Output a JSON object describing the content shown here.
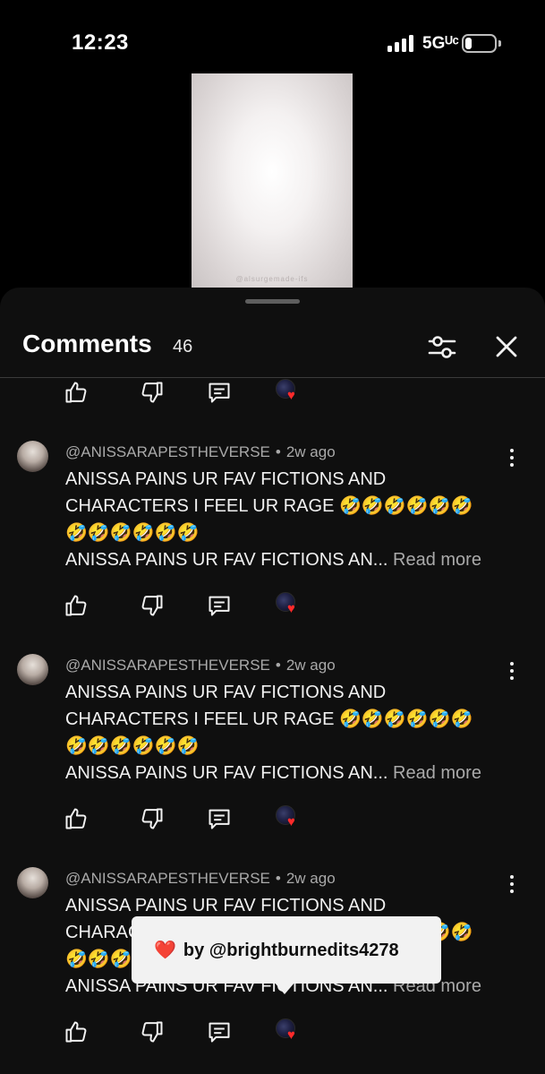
{
  "status_bar": {
    "time": "12:23",
    "network": "5Gᵁᶜ"
  },
  "video": {
    "watermark": "@alsurgemade-ifs"
  },
  "comments_panel": {
    "title": "Comments",
    "count": "46"
  },
  "comments": [
    {
      "username": "@ANISSARAPESTHEVERSE",
      "separator": "•",
      "time": "2w ago",
      "lines": [
        "ANISSA PAINS UR FAV FICTIONS AND",
        "CHARACTERS I FEEL UR RAGE 🤣🤣🤣🤣🤣🤣",
        "🤣🤣🤣🤣🤣🤣",
        "ANISSA PAINS UR FAV FICTIONS AN..."
      ],
      "read_more": "Read more"
    },
    {
      "username": "@ANISSARAPESTHEVERSE",
      "separator": "•",
      "time": "2w ago",
      "lines": [
        "ANISSA PAINS UR FAV FICTIONS AND",
        "CHARACTERS I FEEL UR RAGE 🤣🤣🤣🤣🤣🤣",
        "🤣🤣🤣🤣🤣🤣",
        "ANISSA PAINS UR FAV FICTIONS AN..."
      ],
      "read_more": "Read more"
    },
    {
      "username": "@ANISSARAPESTHEVERSE",
      "separator": "•",
      "time": "2w ago",
      "lines": [
        "ANISSA PAINS UR FAV FICTIONS AND",
        "CHARACTERS I FEEL UR RAGE 🤣🤣🤣🤣🤣🤣",
        "🤣🤣🤣🤣🤣🤣",
        "ANISSA PAINS UR FAV FICTIONS AN..."
      ],
      "read_more": "Read more"
    }
  ],
  "toast": {
    "heart": "❤️",
    "text": "by @brightburnedits4278"
  },
  "icons": {
    "like": "thumbs-up-icon",
    "dislike": "thumbs-down-icon",
    "reply": "reply-icon",
    "creator_heart": "creator-heart-icon",
    "filter": "filter-icon",
    "close": "close-icon",
    "more": "more-vertical-icon"
  },
  "colors": {
    "sheet_bg": "#0f0f0f",
    "heart": "#ff2a2a",
    "toast_bg": "#f2f2f2"
  }
}
